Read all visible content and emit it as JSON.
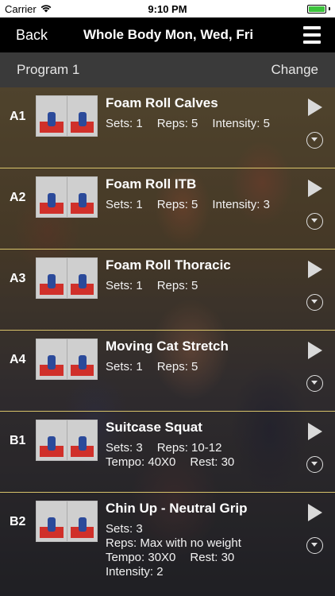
{
  "status": {
    "carrier": "Carrier",
    "time": "9:10 PM"
  },
  "nav": {
    "back_label": "Back",
    "title": "Whole Body Mon, Wed, Fri",
    "menu_icon": "menu-icon"
  },
  "program": {
    "label": "Program 1",
    "change_label": "Change"
  },
  "exercises": [
    {
      "code": "A1",
      "name": "Foam Roll Calves",
      "lines": [
        [
          "Sets: 1",
          "Reps: 5",
          "Intensity: 5"
        ]
      ]
    },
    {
      "code": "A2",
      "name": "Foam Roll ITB",
      "lines": [
        [
          "Sets: 1",
          "Reps: 5",
          "Intensity: 3"
        ]
      ]
    },
    {
      "code": "A3",
      "name": "Foam Roll Thoracic",
      "lines": [
        [
          "Sets: 1",
          "Reps: 5"
        ]
      ]
    },
    {
      "code": "A4",
      "name": "Moving Cat Stretch",
      "lines": [
        [
          "Sets: 1",
          "Reps: 5"
        ]
      ]
    },
    {
      "code": "B1",
      "name": "Suitcase Squat",
      "lines": [
        [
          "Sets: 3",
          "Reps: 10-12"
        ],
        [
          "Tempo: 40X0",
          "Rest: 30"
        ]
      ]
    },
    {
      "code": "B2",
      "name": "Chin Up - Neutral Grip",
      "lines": [
        [
          "Sets: 3"
        ],
        [
          "Reps: Max with no weight"
        ],
        [
          "Tempo: 30X0",
          "Rest: 30"
        ],
        [
          "Intensity: 2"
        ]
      ]
    }
  ],
  "colors": {
    "row_divider": "#d8c36a",
    "nav_background": "#000000",
    "program_bar": "#3a3a3a"
  }
}
